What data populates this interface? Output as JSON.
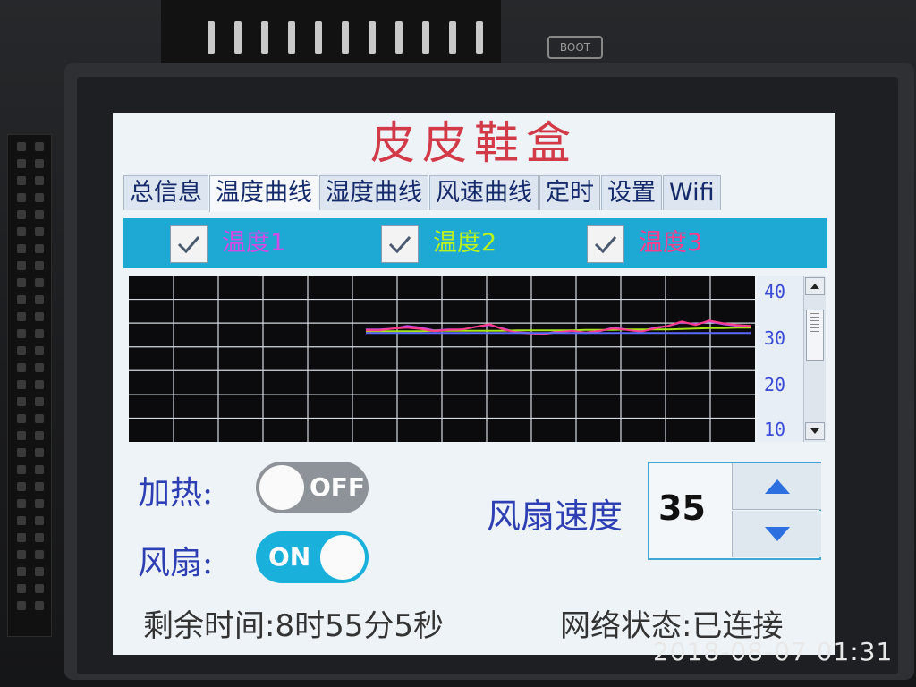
{
  "app": {
    "title": "皮皮鞋盒"
  },
  "tabs": [
    {
      "label": "总信息",
      "active": false
    },
    {
      "label": "温度曲线",
      "active": true
    },
    {
      "label": "湿度曲线",
      "active": false
    },
    {
      "label": "风速曲线",
      "active": false
    },
    {
      "label": "定时",
      "active": false
    },
    {
      "label": "设置",
      "active": false
    },
    {
      "label": "Wifi",
      "active": false
    }
  ],
  "series_toggles": [
    {
      "label": "温度1",
      "checked": true,
      "color": "#d24be6"
    },
    {
      "label": "温度2",
      "checked": true,
      "color": "#b9f21e"
    },
    {
      "label": "温度3",
      "checked": true,
      "color": "#ff3c8c"
    }
  ],
  "chart_data": {
    "type": "line",
    "title": "",
    "xlabel": "",
    "ylabel": "",
    "ylim": [
      5,
      42
    ],
    "yticks": [
      "40",
      "30",
      "20",
      "10"
    ],
    "grid": true,
    "x": [
      0,
      1,
      2,
      3,
      4,
      5,
      6,
      7,
      8,
      9,
      10,
      11,
      12,
      13,
      14,
      15,
      16,
      17,
      18,
      19,
      20,
      21,
      22,
      23,
      24,
      25,
      26,
      27,
      28
    ],
    "series": [
      {
        "name": "温度1",
        "color": "#c548e0",
        "values": [
          30.0,
          30.0,
          30.2,
          30.8,
          30.4,
          29.8,
          30.0,
          30.0,
          30.6,
          31.0,
          30.2,
          29.4,
          29.2,
          29.0,
          29.6,
          29.8,
          29.2,
          29.6,
          30.4,
          30.0,
          29.6,
          30.4,
          30.8,
          31.6,
          31.2,
          31.8,
          31.2,
          30.8,
          30.6
        ]
      },
      {
        "name": "温度2",
        "color": "#a6e51a",
        "values": [
          29.6,
          29.6,
          29.6,
          29.6,
          29.6,
          29.7,
          29.7,
          29.7,
          29.7,
          29.7,
          29.7,
          29.8,
          29.8,
          29.8,
          29.8,
          29.8,
          29.9,
          29.9,
          29.9,
          30.0,
          30.0,
          30.0,
          30.0,
          30.1,
          30.2,
          30.3,
          30.3,
          30.4,
          30.4
        ]
      },
      {
        "name": "温度3",
        "color": "#ff3d8a",
        "values": [
          29.8,
          29.8,
          30.2,
          30.4,
          30.1,
          29.6,
          29.9,
          30.0,
          30.6,
          31.2,
          30.0,
          29.3,
          29.1,
          29.0,
          29.4,
          29.7,
          29.3,
          29.7,
          30.2,
          29.9,
          29.5,
          30.2,
          30.8,
          31.8,
          31.0,
          32.0,
          31.4,
          31.0,
          30.8
        ]
      },
      {
        "name": "",
        "color": "#5a6bff",
        "values": [
          29.2,
          29.2,
          29.2,
          29.2,
          29.2,
          29.2,
          29.2,
          29.2,
          29.2,
          29.2,
          29.2,
          29.2,
          29.2,
          29.2,
          29.2,
          29.2,
          29.2,
          29.2,
          29.2,
          29.2,
          29.2,
          29.2,
          29.2,
          29.2,
          29.2,
          29.2,
          29.2,
          29.2,
          29.2
        ]
      }
    ]
  },
  "controls": {
    "heat_label": "加热:",
    "heat_state": "OFF",
    "fan_label": "风扇:",
    "fan_state": "ON",
    "fan_speed_label": "风扇速度",
    "fan_speed_value": "35"
  },
  "footer": {
    "remaining": "剩余时间:8时55分5秒",
    "network": "网络状态:已连接"
  },
  "device": {
    "boot_label": "BOOT",
    "photo_timestamp": "2018-08-07  01:31"
  },
  "icons": {
    "checkbox": "check-icon",
    "scroll_up": "arrow-up-icon",
    "scroll_down": "arrow-down-icon",
    "spin_up": "triangle-up-icon",
    "spin_down": "triangle-down-icon"
  }
}
